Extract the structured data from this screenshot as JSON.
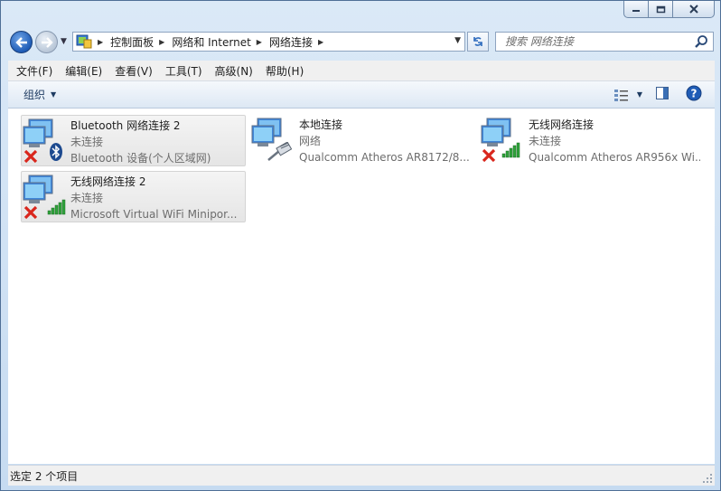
{
  "window": {
    "caption_buttons": [
      "minimize-icon",
      "maximize-icon",
      "close-icon"
    ]
  },
  "address_bar": {
    "crumbs": [
      "控制面板",
      "网络和 Internet",
      "网络连接"
    ]
  },
  "search": {
    "placeholder": "搜索 网络连接"
  },
  "menu": {
    "items": [
      "文件(F)",
      "编辑(E)",
      "查看(V)",
      "工具(T)",
      "高级(N)",
      "帮助(H)"
    ]
  },
  "toolbar": {
    "organize_label": "组织"
  },
  "connections": [
    {
      "name": "Bluetooth 网络连接 2",
      "status": "未连接",
      "device": "Bluetooth 设备(个人区域网)",
      "kind": "bluetooth",
      "disconnected": true,
      "selected": true
    },
    {
      "name": "本地连接",
      "status": "网络",
      "device": "Qualcomm Atheros AR8172/8...",
      "kind": "ethernet",
      "disconnected": false,
      "selected": false
    },
    {
      "name": "无线网络连接",
      "status": "未连接",
      "device": "Qualcomm Atheros AR956x Wi...",
      "kind": "wireless",
      "disconnected": true,
      "selected": false
    },
    {
      "name": "无线网络连接 2",
      "status": "未连接",
      "device": "Microsoft Virtual WiFi Minipor...",
      "kind": "wireless",
      "disconnected": true,
      "selected": true
    }
  ],
  "statusbar": {
    "text": "选定 2 个项目"
  },
  "colors": {
    "accent": "#1f5cb6",
    "error_x": "#d9261c",
    "signal_green": "#2fa33b"
  }
}
